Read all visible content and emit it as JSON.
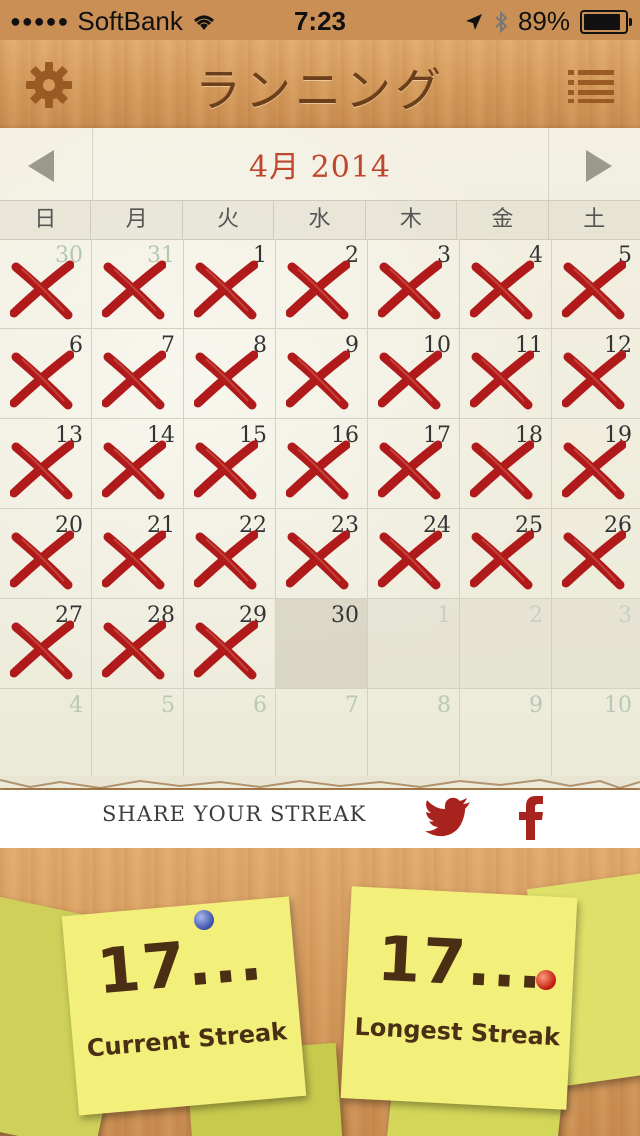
{
  "status_bar": {
    "carrier": "SoftBank",
    "time": "7:23",
    "battery": "89%",
    "battery_level": 0.89
  },
  "nav": {
    "title": "ランニング",
    "settings_icon": "gear-icon",
    "menu_icon": "list-icon"
  },
  "calendar": {
    "month_title": "4月 2014",
    "weekdays": [
      "日",
      "月",
      "火",
      "水",
      "木",
      "金",
      "土"
    ],
    "weeks": [
      [
        {
          "d": "30",
          "state": "done-other"
        },
        {
          "d": "31",
          "state": "done-other"
        },
        {
          "d": "1",
          "state": "done"
        },
        {
          "d": "2",
          "state": "done"
        },
        {
          "d": "3",
          "state": "done"
        },
        {
          "d": "4",
          "state": "done"
        },
        {
          "d": "5",
          "state": "done"
        }
      ],
      [
        {
          "d": "6",
          "state": "done"
        },
        {
          "d": "7",
          "state": "done"
        },
        {
          "d": "8",
          "state": "done"
        },
        {
          "d": "9",
          "state": "done"
        },
        {
          "d": "10",
          "state": "done"
        },
        {
          "d": "11",
          "state": "done"
        },
        {
          "d": "12",
          "state": "done"
        }
      ],
      [
        {
          "d": "13",
          "state": "done"
        },
        {
          "d": "14",
          "state": "done"
        },
        {
          "d": "15",
          "state": "done"
        },
        {
          "d": "16",
          "state": "done"
        },
        {
          "d": "17",
          "state": "done"
        },
        {
          "d": "18",
          "state": "done"
        },
        {
          "d": "19",
          "state": "done"
        }
      ],
      [
        {
          "d": "20",
          "state": "done"
        },
        {
          "d": "21",
          "state": "done"
        },
        {
          "d": "22",
          "state": "done"
        },
        {
          "d": "23",
          "state": "done"
        },
        {
          "d": "24",
          "state": "done"
        },
        {
          "d": "25",
          "state": "done"
        },
        {
          "d": "26",
          "state": "done"
        }
      ],
      [
        {
          "d": "27",
          "state": "done"
        },
        {
          "d": "28",
          "state": "done"
        },
        {
          "d": "29",
          "state": "done"
        },
        {
          "d": "30",
          "state": "today"
        },
        {
          "d": "1",
          "state": "future"
        },
        {
          "d": "2",
          "state": "future"
        },
        {
          "d": "3",
          "state": "future"
        }
      ],
      [
        {
          "d": "4",
          "state": "trail"
        },
        {
          "d": "5",
          "state": "trail"
        },
        {
          "d": "6",
          "state": "trail"
        },
        {
          "d": "7",
          "state": "trail"
        },
        {
          "d": "8",
          "state": "trail"
        },
        {
          "d": "9",
          "state": "trail"
        },
        {
          "d": "10",
          "state": "trail"
        }
      ]
    ]
  },
  "share": {
    "label": "SHARE YOUR STREAK",
    "twitter_icon": "twitter-icon",
    "facebook_icon": "facebook-icon"
  },
  "stats": {
    "current_value": "17...",
    "current_label": "Current Streak",
    "longest_value": "17...",
    "longest_label": "Longest Streak"
  },
  "colors": {
    "accent_red": "#c0462e",
    "x_red": "#b01a1a",
    "wood": "#d49a5b",
    "note_yellow": "#f2ef7a"
  }
}
